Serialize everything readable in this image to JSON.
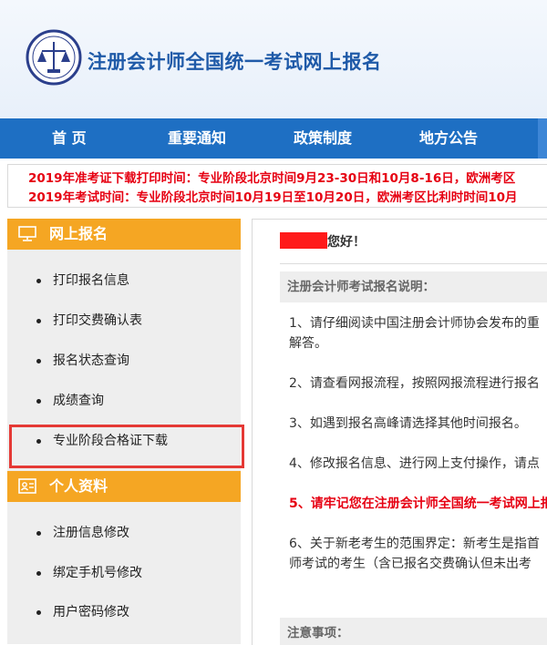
{
  "header": {
    "title": "注册会计师全国统一考试网上报名"
  },
  "nav": {
    "items": [
      "首 页",
      "重要通知",
      "政策制度",
      "地方公告"
    ]
  },
  "notice": {
    "lines": [
      "2019年准考证下载打印时间：专业阶段北京时间9月23-30日和10月8-16日，欧洲考区",
      "2019年考试时间：专业阶段北京时间10月19日至10月20日，欧洲考区比利时时间10月"
    ]
  },
  "sidebar": {
    "section1_title": "网上报名",
    "section1_items": [
      "打印报名信息",
      "打印交费确认表",
      "报名状态查询",
      "成绩查询",
      "专业阶段合格证下载"
    ],
    "section2_title": "个人资料",
    "section2_items": [
      "注册信息修改",
      "绑定手机号修改",
      "用户密码修改"
    ]
  },
  "content": {
    "greeting_suffix": "您好！",
    "subhead": "注册会计师考试报名说明：",
    "paragraphs": [
      "1、请仔细阅读中国注册会计师协会发布的重",
      "解答。",
      "2、请查看网报流程，按照网报流程进行报名",
      "3、如遇到报名高峰请选择其他时间报名。",
      "4、修改报名信息、进行网上支付操作，请点",
      "5、请牢记您在注册会计师全国统一考试网上报",
      "6、关于新老考生的范围界定：新考生是指首",
      "师考试的考生（含已报名交费确认但未出考"
    ],
    "notes_head": "注意事项："
  },
  "colors": {
    "nav": "#1e6fc3",
    "title": "#1f5aa8",
    "section": "#f5a623",
    "alert": "#e60012",
    "highlight": "#e53935"
  }
}
